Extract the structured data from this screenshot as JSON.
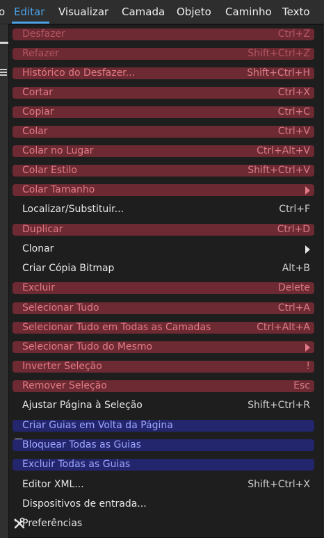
{
  "menubar": {
    "items": [
      {
        "label": "o"
      },
      {
        "label": "Editar"
      },
      {
        "label": "Visualizar"
      },
      {
        "label": "Camada"
      },
      {
        "label": "Objeto"
      },
      {
        "label": "Caminho"
      },
      {
        "label": "Texto"
      }
    ]
  },
  "menu": {
    "items": [
      {
        "label": "Desfazer",
        "shortcut": "Ctrl+Z"
      },
      {
        "label": "Refazer",
        "shortcut": "Shift+Ctrl+Z"
      },
      {
        "label": "Histórico do Desfazer...",
        "shortcut": "Shift+Ctrl+H"
      },
      {
        "label": "Cortar",
        "shortcut": "Ctrl+X"
      },
      {
        "label": "Copiar",
        "shortcut": "Ctrl+C"
      },
      {
        "label": "Colar",
        "shortcut": "Ctrl+V"
      },
      {
        "label": "Colar no Lugar",
        "shortcut": "Ctrl+Alt+V"
      },
      {
        "label": "Colar Estilo",
        "shortcut": "Shift+Ctrl+V"
      },
      {
        "label": "Colar Tamanho",
        "shortcut": ""
      },
      {
        "label": "Localizar/Substituir...",
        "shortcut": "Ctrl+F"
      },
      {
        "label": "Duplicar",
        "shortcut": "Ctrl+D"
      },
      {
        "label": "Clonar",
        "shortcut": ""
      },
      {
        "label": "Criar Cópia Bitmap",
        "shortcut": "Alt+B"
      },
      {
        "label": "Excluir",
        "shortcut": "Delete"
      },
      {
        "label": "Selecionar Tudo",
        "shortcut": "Ctrl+A"
      },
      {
        "label": "Selecionar Tudo em Todas as Camadas",
        "shortcut": "Ctrl+Alt+A"
      },
      {
        "label": "Selecionar Tudo do Mesmo",
        "shortcut": ""
      },
      {
        "label": "Inverter Seleção",
        "shortcut": "!"
      },
      {
        "label": "Remover Seleção",
        "shortcut": "Esc"
      },
      {
        "label": "Ajustar Página à Seleção",
        "shortcut": "Shift+Ctrl+R"
      },
      {
        "label": "Criar Guias em Volta da Página",
        "shortcut": ""
      },
      {
        "label": "Bloquear Todas as Guias",
        "shortcut": ""
      },
      {
        "label": "Excluir Todas as Guias",
        "shortcut": ""
      },
      {
        "label": "Editor XML...",
        "shortcut": "Shift+Ctrl+X"
      },
      {
        "label": "Dispositivos de entrada...",
        "shortcut": ""
      },
      {
        "label": "Preferências",
        "shortcut": ""
      }
    ]
  },
  "colors": {
    "highlight_red": "#6e2a32",
    "highlight_blue": "#23266d",
    "accent": "#4ba3e8"
  },
  "icons": {
    "submenu": "chevron-right-icon",
    "checkbox": "checkbox-icon",
    "preferences": "tools-icon"
  }
}
